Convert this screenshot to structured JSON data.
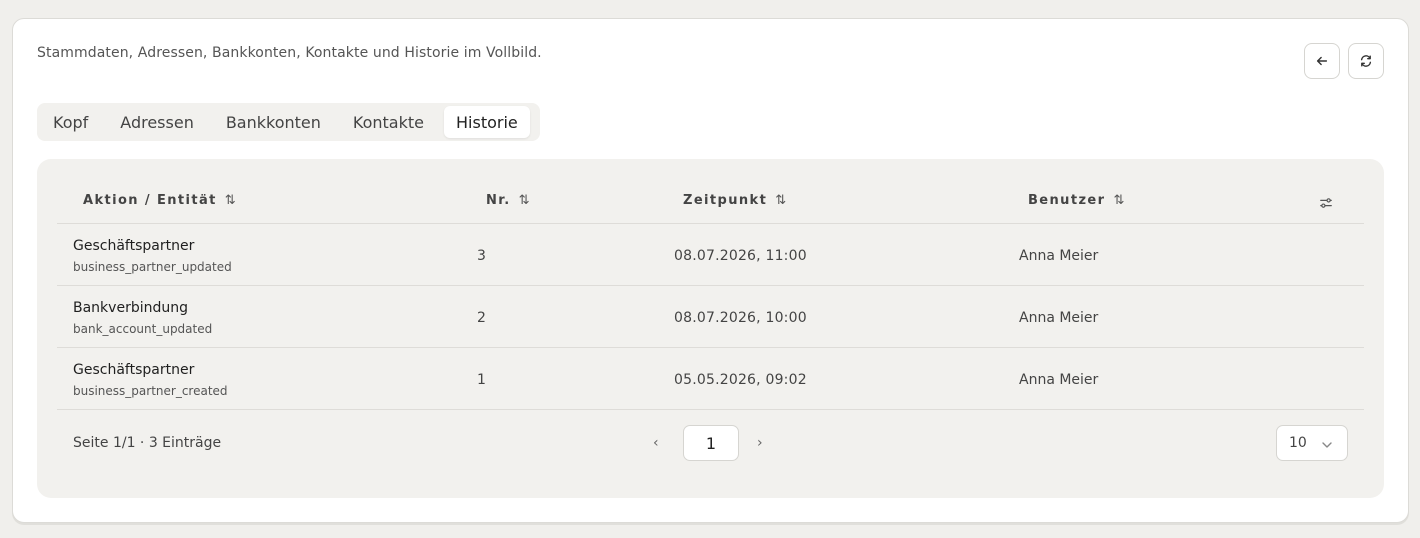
{
  "subtitle": "Stammdaten, Adressen, Bankkonten, Kontakte und Historie im Vollbild.",
  "tabs": [
    {
      "label": "Kopf"
    },
    {
      "label": "Adressen"
    },
    {
      "label": "Bankkonten"
    },
    {
      "label": "Kontakte"
    },
    {
      "label": "Historie",
      "active": true
    }
  ],
  "table": {
    "columns": {
      "aktion": "Aktion / Entität",
      "nr": "Nr.",
      "zeitpunkt": "Zeitpunkt",
      "benutzer": "Benutzer"
    },
    "sort_glyph": "⇅",
    "rows": [
      {
        "entity": "Geschäftspartner",
        "action": "business_partner_updated",
        "nr": "3",
        "zeitpunkt": "08.07.2026, 11:00",
        "benutzer": "Anna Meier"
      },
      {
        "entity": "Bankverbindung",
        "action": "bank_account_updated",
        "nr": "2",
        "zeitpunkt": "08.07.2026, 10:00",
        "benutzer": "Anna Meier"
      },
      {
        "entity": "Geschäftspartner",
        "action": "business_partner_created",
        "nr": "1",
        "zeitpunkt": "05.05.2026, 09:02",
        "benutzer": "Anna Meier"
      }
    ]
  },
  "pagination": {
    "info": "Seite 1/1 · 3 Einträge",
    "prev": "‹",
    "next": "›",
    "current_page": "1",
    "page_size": "10"
  },
  "icons": {
    "back": "arrow-left-icon",
    "refresh": "refresh-icon",
    "column_settings": "column-settings-icon",
    "page_size_chevron": "chevron-down-icon"
  }
}
